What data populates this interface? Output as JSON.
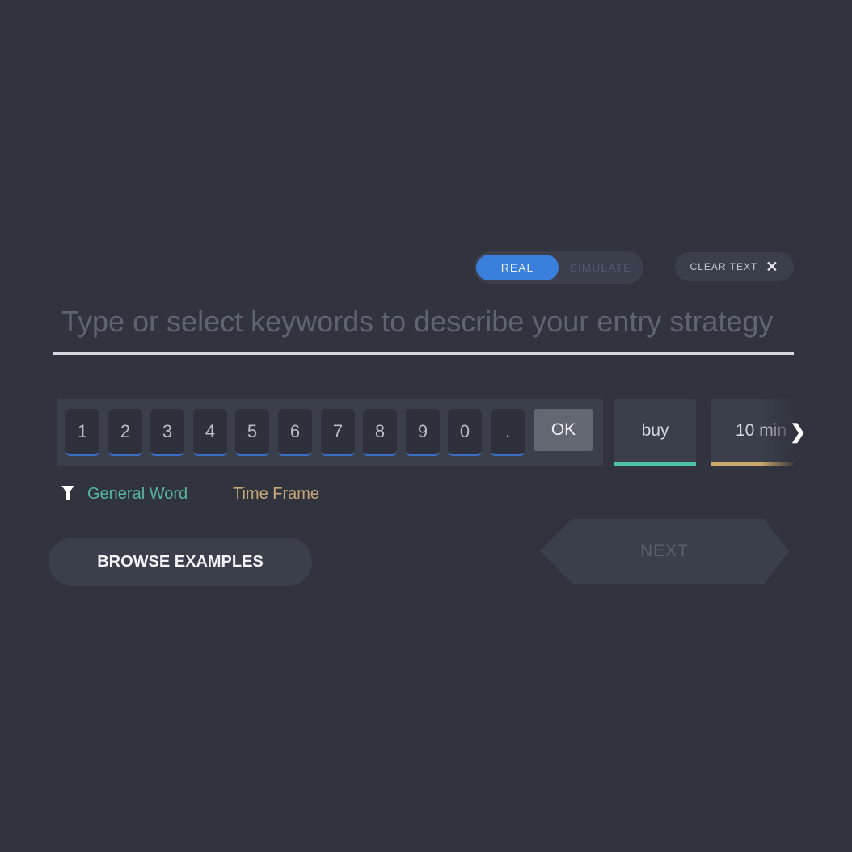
{
  "mode_toggle": {
    "real_label": "REAL",
    "simulate_label": "SIMULATE",
    "selected": "REAL"
  },
  "clear_text": {
    "label": "CLEAR TEXT",
    "icon": "close-icon"
  },
  "strategy_input": {
    "placeholder": "Type or select keywords to describe your entry strategy",
    "value": ""
  },
  "keypad": {
    "keys": [
      "1",
      "2",
      "3",
      "4",
      "5",
      "6",
      "7",
      "8",
      "9",
      "0",
      "."
    ],
    "ok_label": "OK"
  },
  "chips": {
    "buy": "buy",
    "time_frame": "10 min"
  },
  "legend": {
    "icon": "filter-icon",
    "general_word": "General Word",
    "time_frame": "Time Frame"
  },
  "buttons": {
    "browse_examples": "BROWSE EXAMPLES",
    "next": "NEXT"
  },
  "colors": {
    "background": "#31343f",
    "accent_blue": "#3a7fdb",
    "general_word": "#56b89a",
    "time_frame": "#c7a977"
  }
}
